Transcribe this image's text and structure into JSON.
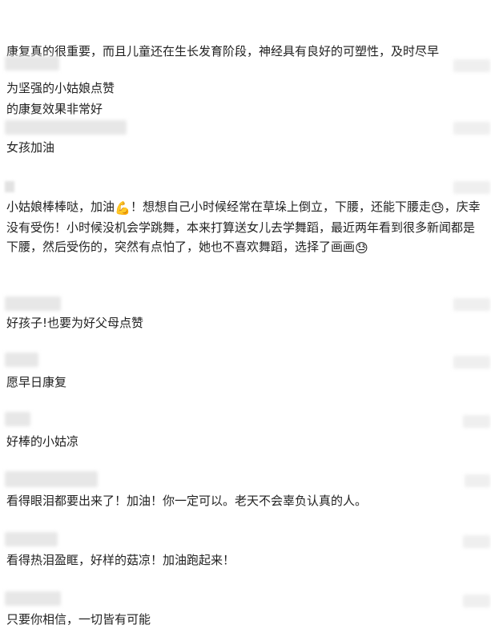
{
  "top_comment": {
    "line1": "康复真的很重要，而且儿童还在生长发育阶段，神经具有良好的可塑性，及时尽早",
    "line2": "的康复效果非常好"
  },
  "comments": [
    {
      "text": "为坚强的小姑娘点赞"
    },
    {
      "text": "女孩加油"
    },
    {
      "part1": "小姑娘棒棒哒，加油",
      "emoji1": "💪",
      "part2": "！想想自己小时候经常在草垛上倒立，下腰，还能下腰走",
      "emoji2": "😓",
      "part3": "，庆幸没有受伤！小时候没机会学跳舞，本来打算送女儿去学舞蹈，最近两年看到很多新闻都是下腰，然后受伤的，突然有点怕了，她也不喜欢舞蹈，选择了画画",
      "emoji3": "😓"
    },
    {
      "text": "好孩子!也要为好父母点赞"
    },
    {
      "text": "愿早日康复"
    },
    {
      "text": "好棒的小姑凉"
    },
    {
      "text": "看得眼泪都要出来了！加油！你一定可以。老天不会辜负认真的人。"
    },
    {
      "text": "看得热泪盈眶，好样的菇凉！加油跑起来！"
    },
    {
      "text": "只要你相信，一切皆有可能"
    }
  ]
}
